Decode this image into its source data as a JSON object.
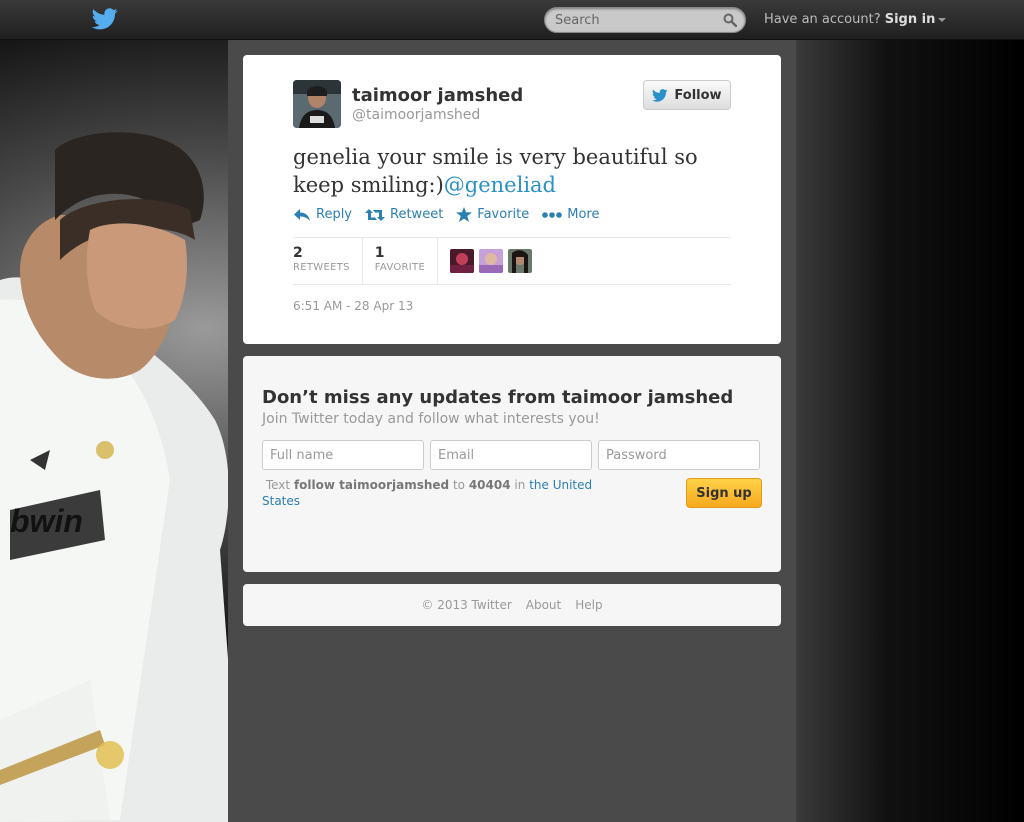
{
  "topbar": {
    "search_placeholder": "Search",
    "account_prompt": "Have an account?",
    "sign_in_label": "Sign in"
  },
  "tweet": {
    "author_name": "taimoor jamshed",
    "author_handle": "@taimoorjamshed",
    "follow_label": "Follow",
    "text": "genelia your smile is very beautiful so keep smiling:)",
    "mention": "@geneliad",
    "actions": [
      {
        "label": "Reply",
        "icon": "reply-icon"
      },
      {
        "label": "Retweet",
        "icon": "retweet-icon"
      },
      {
        "label": "Favorite",
        "icon": "star-icon"
      },
      {
        "label": "More",
        "icon": "more-dots-icon"
      }
    ],
    "stats": [
      {
        "count": "2",
        "label": "RETWEETS"
      },
      {
        "count": "1",
        "label": "FAVORITE"
      }
    ],
    "timestamp": "6:51 AM - 28 Apr 13"
  },
  "signup": {
    "title": "Don’t miss any updates from taimoor jamshed",
    "subtitle": "Join Twitter today and follow what interests you!",
    "full_name_placeholder": "Full name",
    "email_placeholder": "Email",
    "password_placeholder": "Password",
    "sms_text_prefix": "Text",
    "sms_command": "follow taimoorjamshed",
    "sms_to": "to",
    "sms_number": "40404",
    "sms_in": "in",
    "sms_country": "the United States",
    "signup_label": "Sign up"
  },
  "footer": {
    "copyright": "© 2013 Twitter",
    "about": "About",
    "help": "Help"
  },
  "colors": {
    "link": "#2a7fb3",
    "signup_button": "#f6a91c",
    "brand_bird": "#55acee"
  }
}
